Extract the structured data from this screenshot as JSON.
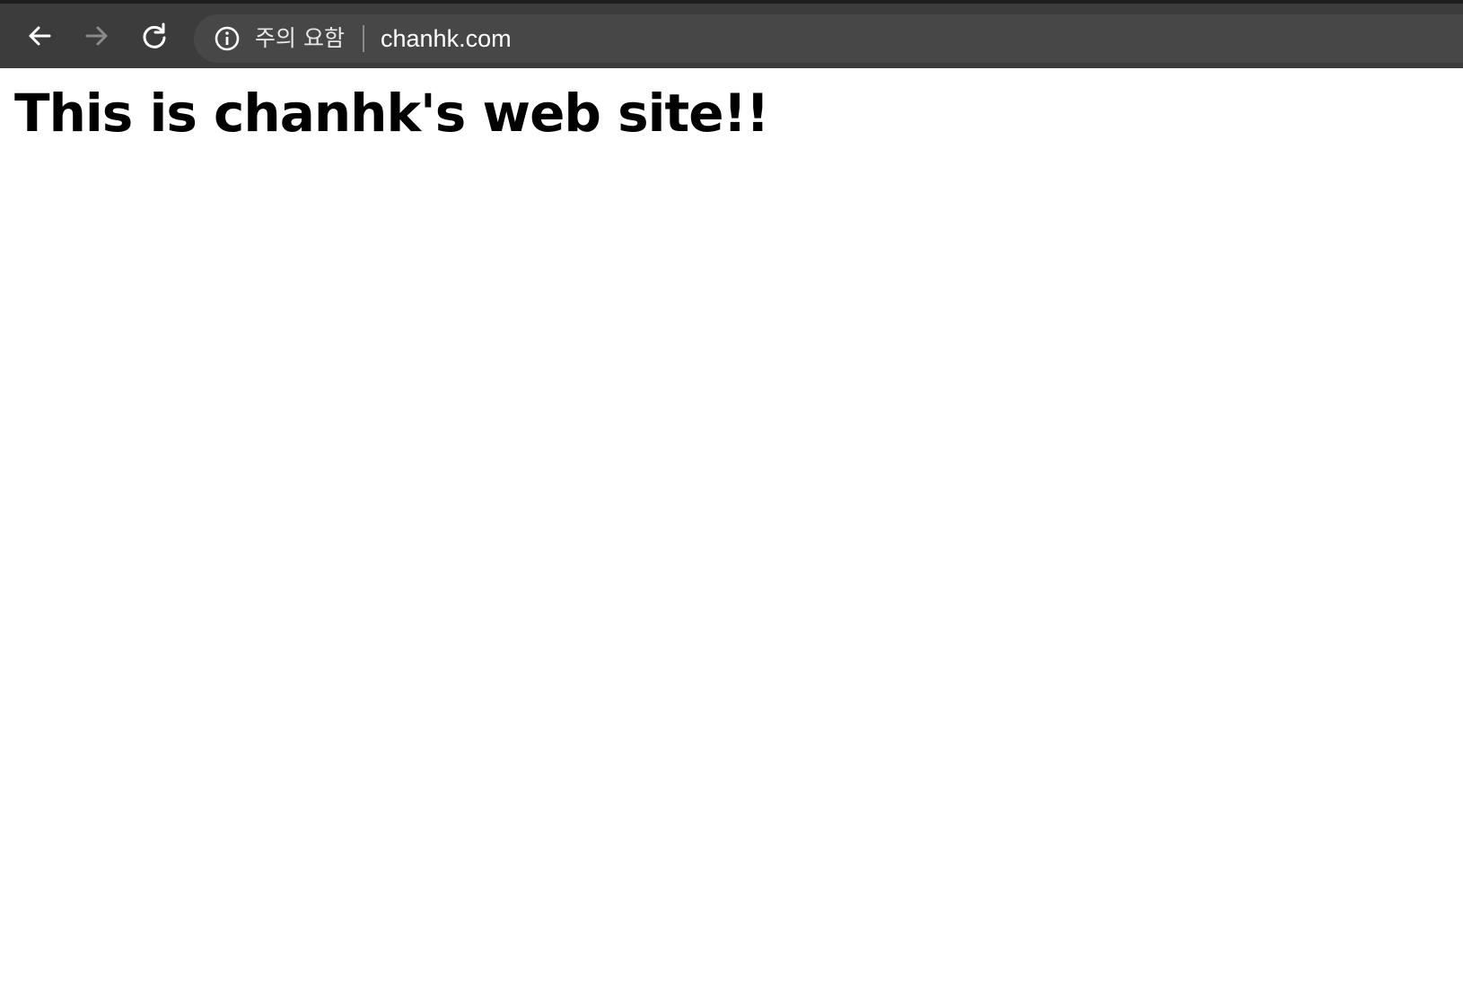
{
  "browser": {
    "security_status": "주의 요함",
    "url": "chanhk.com",
    "icons": {
      "back": "back-arrow-icon",
      "forward": "forward-arrow-icon",
      "reload": "reload-icon",
      "info": "info-icon"
    },
    "colors": {
      "toolbar_bg": "#3c3c3c",
      "omnibox_bg": "#474747",
      "forward_disabled": "#8a8a8a"
    }
  },
  "page": {
    "heading": "This is chanhk's web site!!"
  }
}
